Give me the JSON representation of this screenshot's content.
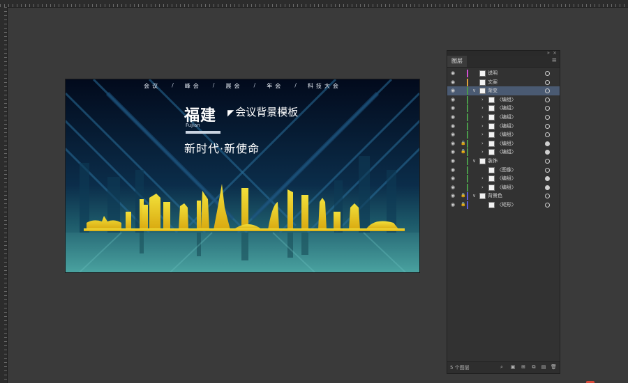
{
  "artboard": {
    "nav_items": [
      "会议",
      "峰会",
      "展会",
      "年会",
      "科技大会"
    ],
    "nav_sep": "/",
    "title_main": "福建",
    "title_pinyin": "Fujian",
    "title_side": "会议背景模板",
    "title_side_mark": "◤",
    "slogan": "新时代·新使命",
    "colors": {
      "background": "#04122a",
      "teal": "#3e8c8f",
      "skyline_gold": "#e8c21e",
      "skyline_yellow": "#f2e03a"
    }
  },
  "layers_panel": {
    "tab_label": "图层",
    "menu_icon": "hamburger-icon",
    "layer_count": "5 个图层",
    "rows": [
      {
        "label": "说明",
        "indent": 0,
        "expander": "",
        "lock": false,
        "color": "#d14fd1",
        "selected": false,
        "target": "hollow"
      },
      {
        "label": "文案",
        "indent": 0,
        "expander": "",
        "lock": false,
        "color": "#e0a03a",
        "selected": false,
        "target": "hollow"
      },
      {
        "label": "渐变",
        "indent": 0,
        "expander": "∨",
        "lock": false,
        "color": "#4a9a4a",
        "selected": true,
        "target": "hollow"
      },
      {
        "label": "〈编组〉",
        "indent": 1,
        "expander": "›",
        "lock": false,
        "color": "#4a9a4a",
        "selected": false,
        "target": "hollow"
      },
      {
        "label": "〈编组〉",
        "indent": 1,
        "expander": "›",
        "lock": false,
        "color": "#4a9a4a",
        "selected": false,
        "target": "hollow"
      },
      {
        "label": "〈编组〉",
        "indent": 1,
        "expander": "›",
        "lock": false,
        "color": "#4a9a4a",
        "selected": false,
        "target": "hollow"
      },
      {
        "label": "〈编组〉",
        "indent": 1,
        "expander": "›",
        "lock": false,
        "color": "#4a9a4a",
        "selected": false,
        "target": "hollow"
      },
      {
        "label": "〈编组〉",
        "indent": 1,
        "expander": "›",
        "lock": false,
        "color": "#4a9a4a",
        "selected": false,
        "target": "hollow"
      },
      {
        "label": "〈编组〉",
        "indent": 1,
        "expander": "›",
        "lock": true,
        "color": "#4a9a4a",
        "selected": false,
        "target": "filled"
      },
      {
        "label": "〈编组〉",
        "indent": 1,
        "expander": "›",
        "lock": true,
        "color": "#4a9a4a",
        "selected": false,
        "target": "filled"
      },
      {
        "label": "装饰",
        "indent": 0,
        "expander": "∨",
        "lock": false,
        "color": "#4a9a4a",
        "selected": false,
        "target": "hollow"
      },
      {
        "label": "〈图像〉",
        "indent": 1,
        "expander": "",
        "lock": false,
        "color": "#4a9a4a",
        "selected": false,
        "target": "hollow"
      },
      {
        "label": "〈编组〉",
        "indent": 1,
        "expander": "›",
        "lock": false,
        "color": "#4a9a4a",
        "selected": false,
        "target": "filled"
      },
      {
        "label": "〈编组〉",
        "indent": 1,
        "expander": "›",
        "lock": false,
        "color": "#4a9a4a",
        "selected": false,
        "target": "filled"
      },
      {
        "label": "背景色",
        "indent": 0,
        "expander": "∨",
        "lock": true,
        "color": "#5a5ad8",
        "selected": false,
        "target": "hollow"
      },
      {
        "label": "〈矩形〉",
        "indent": 1,
        "expander": "",
        "lock": true,
        "color": "#5a5ad8",
        "selected": false,
        "target": "hollow"
      }
    ],
    "footer_icons": [
      "search-icon",
      "clipping-mask-icon",
      "sublayer-icon",
      "new-layer-icon",
      "new-layer-icon",
      "trash-icon"
    ]
  }
}
